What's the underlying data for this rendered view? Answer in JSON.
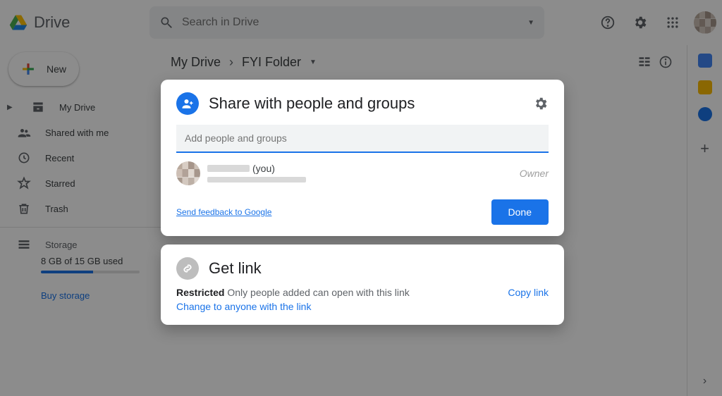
{
  "header": {
    "product": "Drive",
    "search_placeholder": "Search in Drive"
  },
  "sidebar": {
    "new_label": "New",
    "items": [
      {
        "label": "My Drive"
      },
      {
        "label": "Shared with me"
      },
      {
        "label": "Recent"
      },
      {
        "label": "Starred"
      },
      {
        "label": "Trash"
      }
    ],
    "storage_label": "Storage",
    "storage_used": "8 GB of 15 GB used",
    "buy_label": "Buy storage"
  },
  "breadcrumb": {
    "root": "My Drive",
    "current": "FYI Folder"
  },
  "share_dialog": {
    "title": "Share with people and groups",
    "input_placeholder": "Add people and groups",
    "owner_you_suffix": "(you)",
    "owner_role": "Owner",
    "feedback": "Send feedback to Google",
    "done": "Done"
  },
  "getlink": {
    "title": "Get link",
    "restricted": "Restricted",
    "restricted_desc": "Only people added can open with this link",
    "change": "Change to anyone with the link",
    "copy": "Copy link"
  }
}
